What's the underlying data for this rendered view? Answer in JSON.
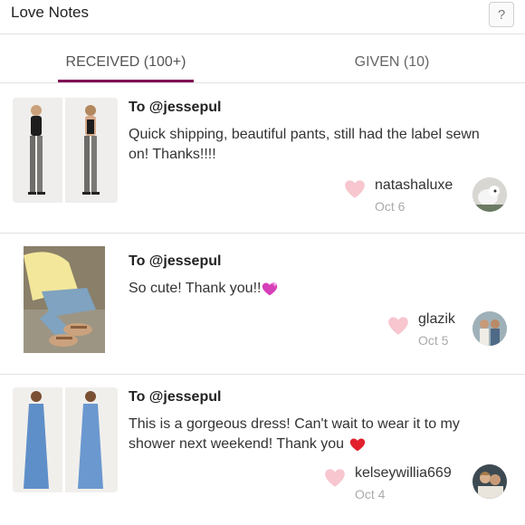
{
  "header": {
    "title": "Love Notes",
    "help_label": "?"
  },
  "tabs": [
    {
      "label": "RECEIVED (100+)",
      "active": true
    },
    {
      "label": "GIVEN (10)",
      "active": false
    }
  ],
  "colors": {
    "accent": "#7f0353",
    "heart": "#f7c6cf"
  },
  "notes": [
    {
      "to": "To @jessepul",
      "message": "Quick shipping, beautiful pants, still had the label sewn on! Thanks!!!!",
      "sender": "natashaluxe",
      "date": "Oct 6"
    },
    {
      "to": "To @jessepul",
      "message": "So cute! Thank you!!",
      "message_emoji": "sparkling-heart-icon",
      "sender": "glazik",
      "date": "Oct 5"
    },
    {
      "to": "To @jessepul",
      "message": "This is a gorgeous dress! Can't wait to wear it to my shower next weekend! Thank you",
      "message_emoji": "red-heart-icon",
      "sender": "kelseywillia669",
      "date": "Oct 4"
    }
  ]
}
